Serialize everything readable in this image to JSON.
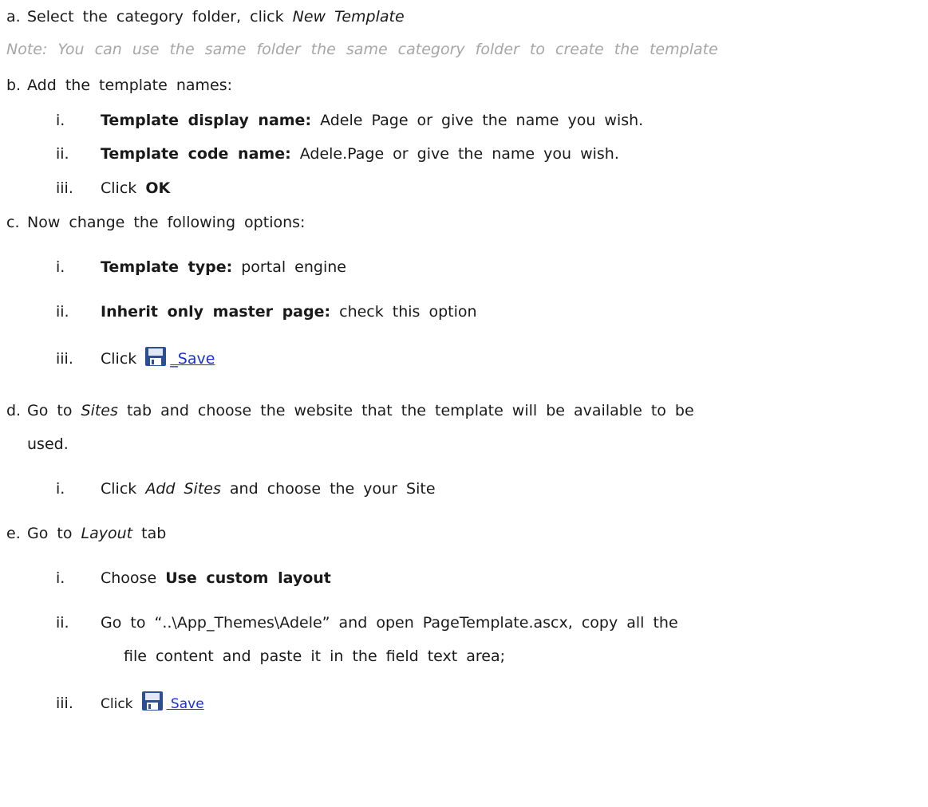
{
  "a": {
    "marker": "a.",
    "pre": "Select the category folder, click ",
    "em": "New Template"
  },
  "note": "Note: You can use the same folder the same category folder to create the template",
  "b": {
    "marker": "b.",
    "text": "Add the template names:",
    "items": [
      {
        "marker": "i.",
        "bold": "Template display name:",
        "rest": " Adele Page or give the name you wish."
      },
      {
        "marker": "ii.",
        "bold": "Template code name:",
        "rest": " Adele.Page or give the name you wish."
      },
      {
        "marker": "iii.",
        "pre": "Click ",
        "bold": "OK"
      }
    ]
  },
  "c": {
    "marker": "c.",
    "text": "Now change the following options:",
    "items": [
      {
        "marker": "i.",
        "bold": "Template type:",
        "rest": " portal engine"
      },
      {
        "marker": "ii.",
        "bold": "Inherit only master page:",
        "rest": " check this option"
      },
      {
        "marker": "iii.",
        "pre": "Click",
        "link": "_Save"
      }
    ]
  },
  "d": {
    "marker": "d.",
    "pre": "Go to ",
    "em": "Sites",
    "post": " tab and choose the website that the template will be available to be",
    "cont": "used.",
    "items": [
      {
        "marker": "i.",
        "pre": "Click ",
        "em": "Add Sites",
        "post": " and choose the your Site"
      }
    ]
  },
  "e": {
    "marker": "e.",
    "pre": "Go to ",
    "em": "Layout",
    "post": " tab",
    "items": [
      {
        "marker": "i.",
        "pre": "Choose ",
        "bold": "Use custom layout"
      },
      {
        "marker": "ii.",
        "text": "Go to “..\\App_Themes\\Adele” and open PageTemplate.ascx, copy all the",
        "cont": "file content and paste it in the field text area;"
      },
      {
        "marker": "iii.",
        "pre": "Click",
        "link": " Save"
      }
    ]
  },
  "icons": {
    "save": "floppy-disk-icon"
  },
  "colors": {
    "text": "#1a1a1a",
    "note": "#a6a6a6",
    "link": "#1a33d6",
    "floppy": "#2b4f8f"
  }
}
